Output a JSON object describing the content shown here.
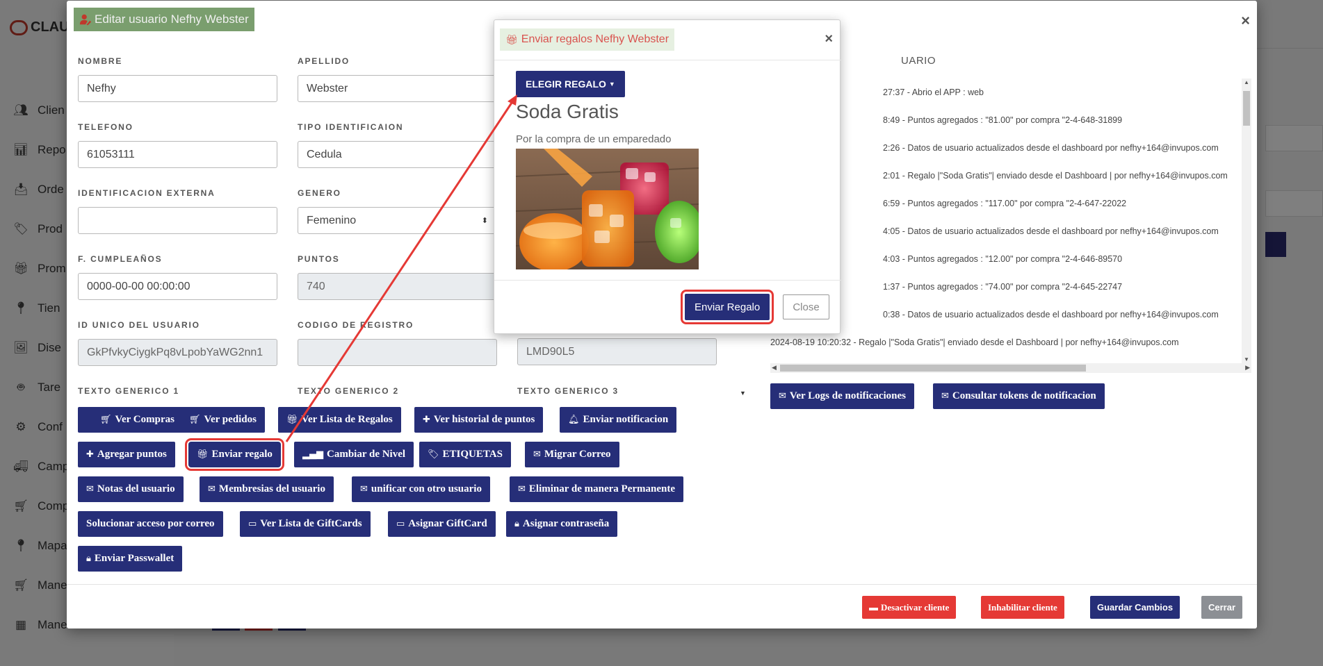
{
  "background": {
    "logo": "CLAU",
    "nav": [
      "Clien",
      "Repo",
      "Orde",
      "Prod",
      "Prom",
      "Tien",
      "Dise",
      "Tare",
      "Conf",
      "Camp",
      "Comp",
      "Mapa",
      "Mane",
      "Mane"
    ]
  },
  "modal": {
    "title": "Editar usuario Nefhy Webster",
    "fields": {
      "nombre": {
        "label": "NOMBRE",
        "value": "Nefhy"
      },
      "apellido": {
        "label": "APELLIDO",
        "value": "Webster"
      },
      "telefono": {
        "label": "TELEFONO",
        "value": "61053111"
      },
      "tipo_id": {
        "label": "TIPO IDENTIFICAION",
        "value": "Cedula"
      },
      "id_externa": {
        "label": "IDENTIFICACION EXTERNA",
        "value": ""
      },
      "genero": {
        "label": "GENERO",
        "value": "Femenino"
      },
      "cumple": {
        "label": "F. CUMPLEAÑOS",
        "value": "0000-00-00 00:00:00"
      },
      "puntos": {
        "label": "PUNTOS",
        "value": "740"
      },
      "id_unico": {
        "label": "ID UNICO DEL USUARIO",
        "value": "GkPfvkyCiygkPq8vLpobYaWG2nn1"
      },
      "codigo_registro": {
        "label": "CODIGO DE REGISTRO",
        "value": ""
      },
      "tercer_campo": {
        "value": "LMD90L5"
      }
    },
    "texto_labels": [
      "TEXTO GENERICO 1",
      "TEXTO GENERICO 2",
      "TEXTO GENERICO 3"
    ],
    "buttons": {
      "ver_compras": "Ver Compras",
      "ver_pedidos": "Ver pedidos",
      "ver_regalos": "Ver Lista de Regalos",
      "ver_historial": "Ver historial de puntos",
      "enviar_notif": "Enviar notificacion",
      "agregar_puntos": "Agregar puntos",
      "enviar_regalo": "Enviar regalo",
      "cambiar_nivel": "Cambiar de Nivel",
      "etiquetas": "ETIQUETAS",
      "migrar_correo": "Migrar Correo",
      "notas": "Notas del usuario",
      "membresias": "Membresias del usuario",
      "unificar": "unificar con otro usuario",
      "eliminar": "Eliminar de manera Permanente",
      "solucionar": "Solucionar acceso por correo",
      "giftcards": "Ver Lista de GiftCards",
      "asignar_giftcard": "Asignar GiftCard",
      "asignar_pass": "Asignar contraseña",
      "passwallet": "Enviar Passwallet",
      "ver_logs": "Ver Logs de notificaciones",
      "tokens": "Consultar tokens de notificacion"
    },
    "footer": {
      "desactivar": "Desactivar cliente",
      "inhabilitar": "Inhabilitar cliente",
      "guardar": "Guardar Cambios",
      "cerrar": "Cerrar"
    },
    "logs_title": "UARIO",
    "logs": [
      "27:37 - Abrio el APP : web",
      "8:49 - Puntos agregados : \"81.00\" por compra \"2-4-648-31899",
      "2:26 - Datos de usuario actualizados desde el dashboard por nefhy+164@invupos.com",
      "2:01 - Regalo |\"Soda Gratis\"| enviado desde el Dashboard | por nefhy+164@invupos.com",
      "6:59 - Puntos agregados : \"117.00\" por compra \"2-4-647-22022",
      "4:05 - Datos de usuario actualizados desde el dashboard por nefhy+164@invupos.com",
      "4:03 - Puntos agregados : \"12.00\" por compra \"2-4-646-89570",
      "1:37 - Puntos agregados : \"74.00\" por compra \"2-4-645-22747",
      "0:38 - Datos de usuario actualizados desde el dashboard por nefhy+164@invupos.com",
      "2024-08-19 10:20:32 - Regalo |\"Soda Gratis\"| enviado desde el Dashboard | por nefhy+164@invupos.com"
    ]
  },
  "gift_modal": {
    "title": "Enviar regalos Nefhy Webster",
    "dropdown": "ELEGIR REGALO",
    "gift_name": "Soda Gratis",
    "gift_desc": "Por la compra de un emparedado",
    "send": "Enviar Regalo",
    "close": "Close"
  },
  "colors": {
    "primary": "#262e78",
    "danger": "#e53935",
    "title_green": "#7a9e6e",
    "gift_title_red": "#d9534f"
  }
}
